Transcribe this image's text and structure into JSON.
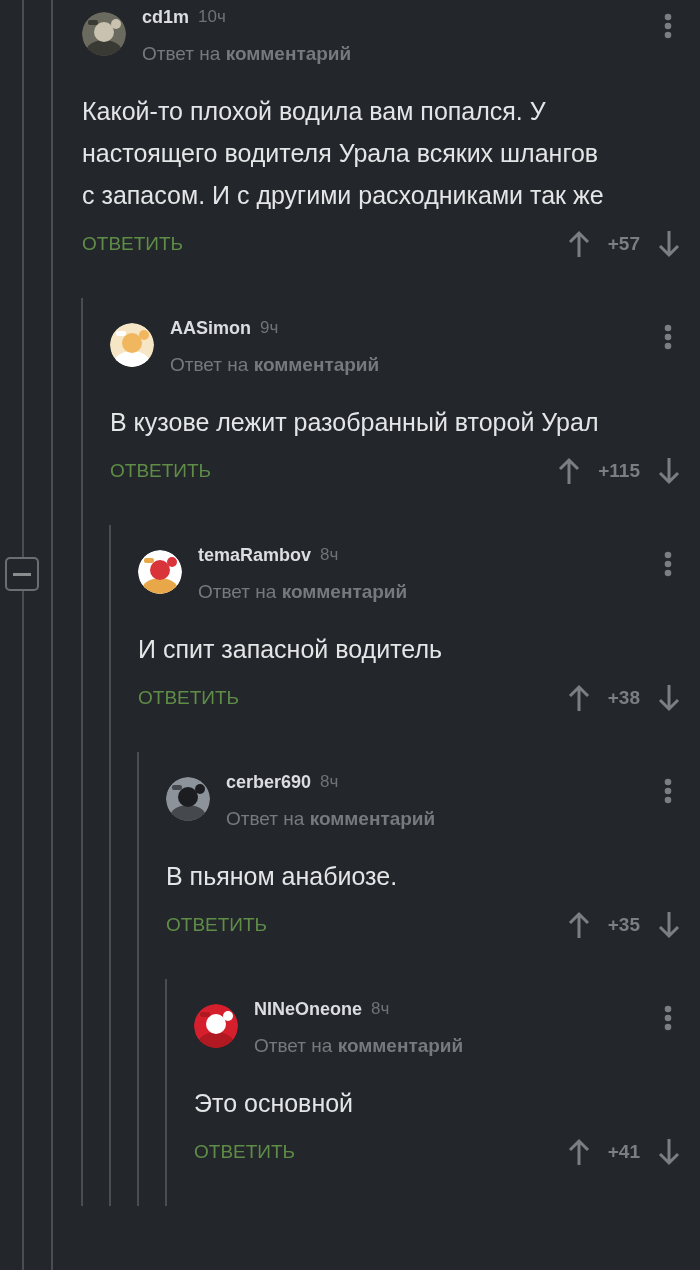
{
  "thread": {
    "author": "cd1m",
    "time": "10ч",
    "subtitle": "Ответ на **комментарий**",
    "text": "Какой-то плохой водила вам попался. У настоящего водителя Урала всяких шлангов с запасом. И с другими расходниками так же",
    "reply": "ОТВЕТИТЬ",
    "score": "+57",
    "children": [
      {
        "author": "AASimon",
        "time": "9ч",
        "subtitle": "Ответ на **комментарий**",
        "text": "В кузове лежит разобранный второй Урал",
        "reply": "ОТВЕТИТЬ",
        "score": "+115",
        "children": [
          {
            "author": "temaRambov",
            "time": "8ч",
            "subtitle": "Ответ на **комментарий**",
            "text": "И спит запасной водитель",
            "reply": "ОТВЕТИТЬ",
            "score": "+38",
            "children": [
              {
                "author": "cerber690",
                "time": "8ч",
                "subtitle": "Ответ на **комментарий**",
                "text": "В пьяном анабиозе.",
                "reply": "ОТВЕТИТЬ",
                "score": "+35",
                "children": [
                  {
                    "author": "NINeOneone",
                    "time": "8ч",
                    "subtitle": "Ответ на **комментарий**",
                    "text": "Это основной",
                    "reply": "ОТВЕТИТЬ",
                    "score": "+41"
                  }
                ]
              }
            ]
          }
        ]
      }
    ]
  }
}
